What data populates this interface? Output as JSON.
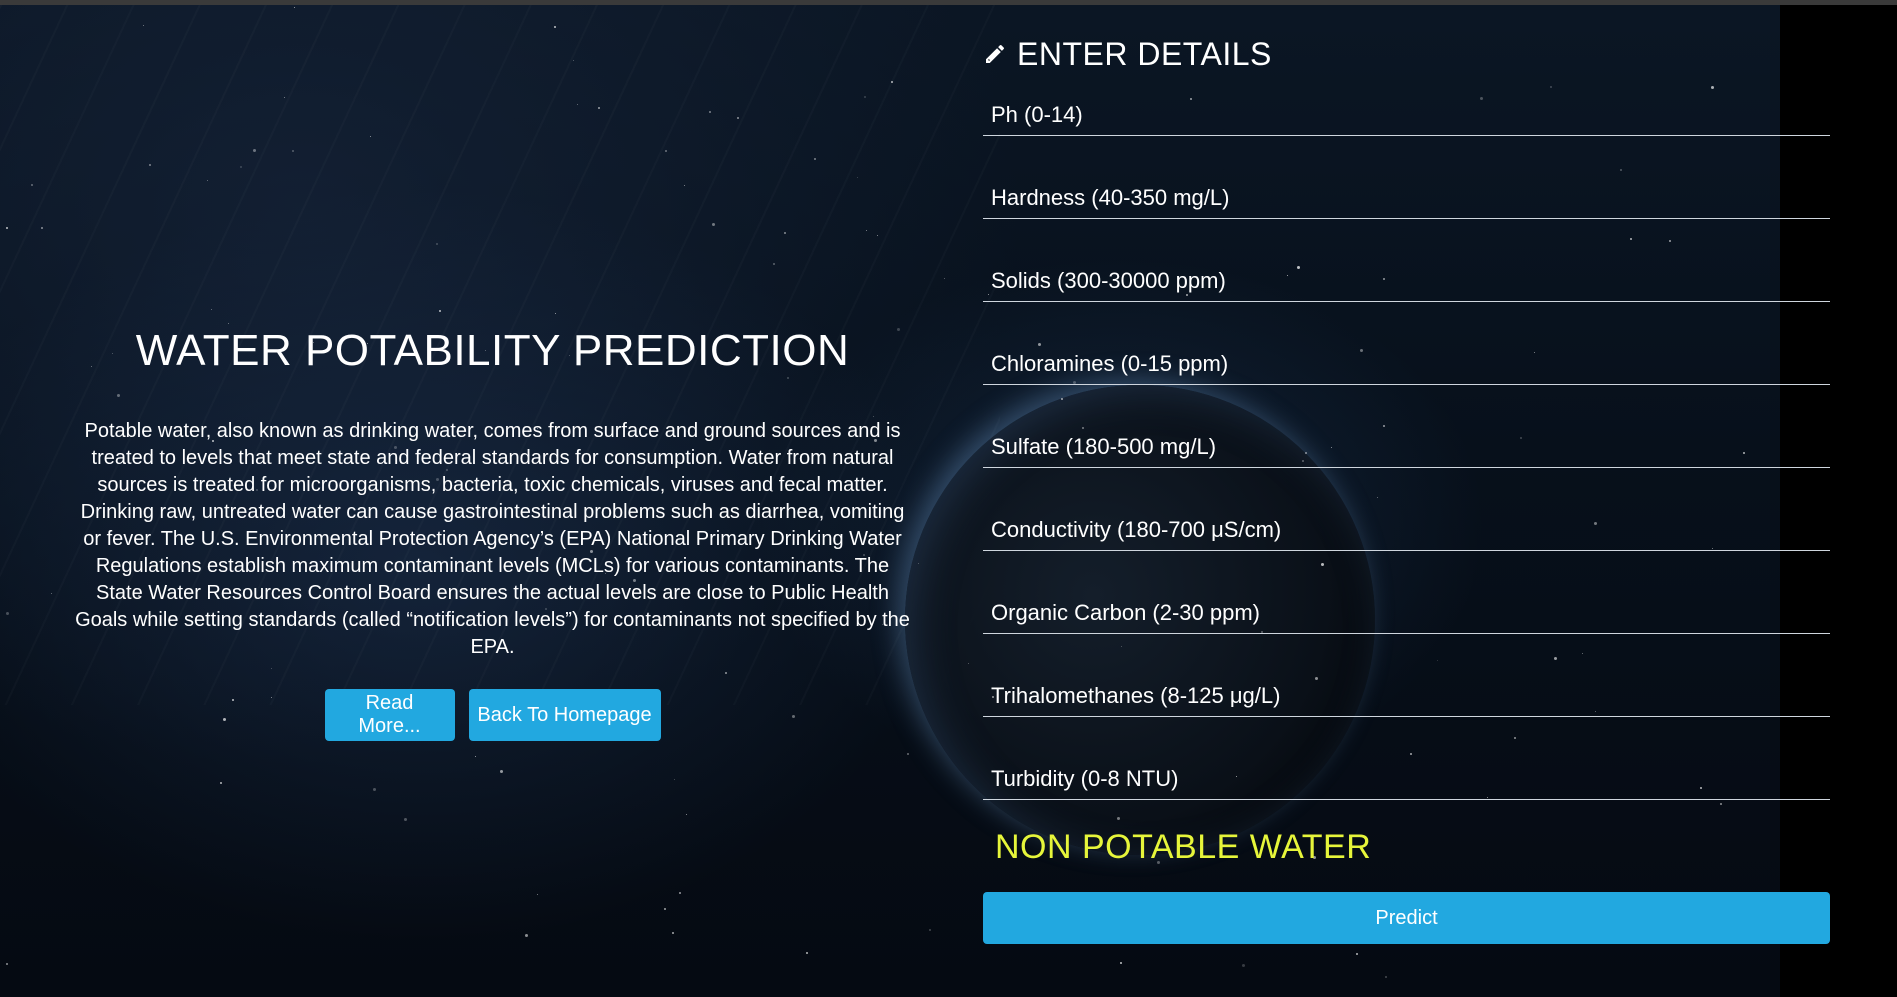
{
  "left": {
    "title": "WATER POTABILITY PREDICTION",
    "description": "Potable water, also known as drinking water, comes from surface and ground sources and is treated to levels that meet state and federal standards for consumption. Water from natural sources is treated for microorganisms, bacteria, toxic chemicals, viruses and fecal matter. Drinking raw, untreated water can cause gastrointestinal problems such as diarrhea, vomiting or fever. The U.S. Environmental Protection Agency’s (EPA) National Primary Drinking Water Regulations establish maximum contaminant levels (MCLs) for various contaminants. The State Water Resources Control Board ensures the actual levels are close to Public Health Goals while setting standards (called “notification levels”) for contaminants not specified by the EPA.",
    "read_more_label": "Read More...",
    "homepage_label": "Back To Homepage"
  },
  "form": {
    "heading": "ENTER DETAILS",
    "heading_icon": "pencil-icon",
    "fields": [
      {
        "placeholder": "Ph (0-14)",
        "value": ""
      },
      {
        "placeholder": "Hardness (40-350 mg/L)",
        "value": ""
      },
      {
        "placeholder": "Solids (300-30000 ppm)",
        "value": ""
      },
      {
        "placeholder": "Chloramines (0-15 ppm)",
        "value": ""
      },
      {
        "placeholder": "Sulfate (180-500 mg/L)",
        "value": ""
      },
      {
        "placeholder": "Conductivity (180-700 μS/cm)",
        "value": ""
      },
      {
        "placeholder": "Organic Carbon (2-30 ppm)",
        "value": ""
      },
      {
        "placeholder": "Trihalomethanes (8-125 μg/L)",
        "value": ""
      },
      {
        "placeholder": "Turbidity (0-8 NTU)",
        "value": ""
      }
    ],
    "result_text": "NON POTABLE WATER",
    "predict_label": "Predict"
  },
  "colors": {
    "accent": "#22a8e0",
    "result": "#e6f53a",
    "background": "#050a12"
  }
}
